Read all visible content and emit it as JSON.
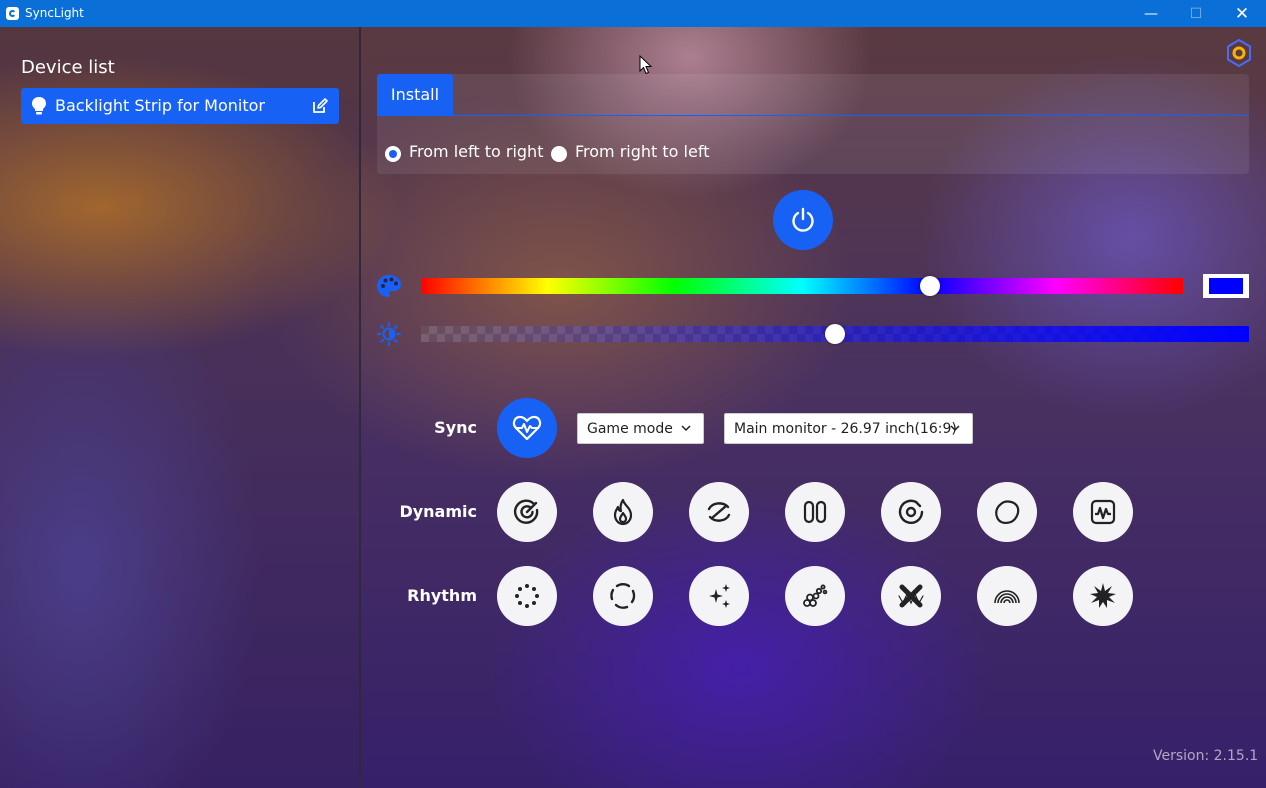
{
  "window": {
    "title": "SyncLight",
    "min_glyph": "—",
    "max_glyph": "☐",
    "close_glyph": "✕"
  },
  "sidebar": {
    "title": "Device list",
    "devices": [
      {
        "label": "Backlight Strip for Monitor",
        "selected": true
      }
    ]
  },
  "install": {
    "tab_label": "Install",
    "options": [
      {
        "label": "From left to right",
        "checked": true
      },
      {
        "label": "From right to left",
        "checked": false
      }
    ]
  },
  "color": {
    "hue_fraction": 0.668,
    "swatch": "#0000ff"
  },
  "brightness": {
    "fraction": 0.5
  },
  "sync": {
    "label": "Sync",
    "mode_select": "Game mode",
    "monitor_select": "Main monitor - 26.97 inch(16:9)"
  },
  "dynamic": {
    "label": "Dynamic",
    "effects": [
      "target-icon",
      "flame-icon",
      "ring-slash-icon",
      "pill-pair-icon",
      "swirl-icon",
      "blob-icon",
      "wave-frame-icon"
    ]
  },
  "rhythm": {
    "label": "Rhythm",
    "effects": [
      "dots-ring-icon",
      "dashed-ring-icon",
      "sparkles-icon",
      "bubbles-icon",
      "cross-wave-icon",
      "rainbow-icon",
      "burst-icon"
    ]
  },
  "footer": {
    "version": "Version: 2.15.1"
  },
  "colors": {
    "accent": "#1762f5",
    "titlebar": "#0a6fd6",
    "settings_ring": "#f5b400"
  }
}
